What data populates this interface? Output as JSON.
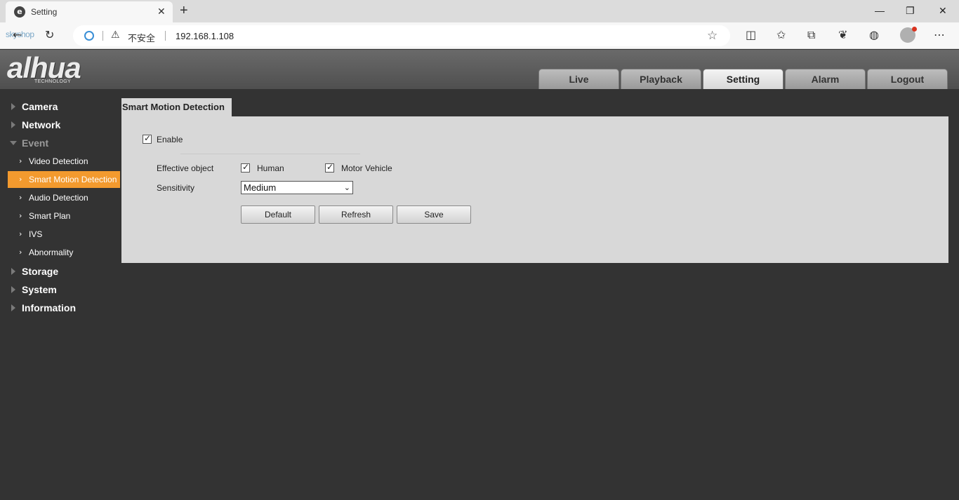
{
  "browser": {
    "tab_title": "Setting",
    "tab_favicon_letter": "e",
    "watermark": "skyshop",
    "security_label": "不安全",
    "url": "192.168.1.108"
  },
  "header": {
    "logo": "alhua",
    "logo_sub": "TECHNOLOGY",
    "tabs": [
      {
        "label": "Live"
      },
      {
        "label": "Playback"
      },
      {
        "label": "Setting"
      },
      {
        "label": "Alarm"
      },
      {
        "label": "Logout"
      }
    ],
    "active_tab": "Setting"
  },
  "sidebar": {
    "groups": {
      "camera": "Camera",
      "network": "Network",
      "event": "Event",
      "storage": "Storage",
      "system": "System",
      "information": "Information"
    },
    "event_items": [
      {
        "label": "Video Detection"
      },
      {
        "label": "Smart Motion Detection"
      },
      {
        "label": "Audio Detection"
      },
      {
        "label": "Smart Plan"
      },
      {
        "label": "IVS"
      },
      {
        "label": "Abnormality"
      }
    ],
    "active_item": "Smart Motion Detection"
  },
  "panel": {
    "title": "Smart Motion Detection",
    "enable_label": "Enable",
    "enable_checked": true,
    "effective_object_label": "Effective object",
    "human_label": "Human",
    "human_checked": true,
    "vehicle_label": "Motor Vehicle",
    "vehicle_checked": true,
    "sensitivity_label": "Sensitivity",
    "sensitivity_value": "Medium",
    "buttons": {
      "default": "Default",
      "refresh": "Refresh",
      "save": "Save"
    }
  },
  "colors": {
    "accent": "#f39a2e",
    "background": "#333333",
    "panel": "#d8d8d8"
  }
}
